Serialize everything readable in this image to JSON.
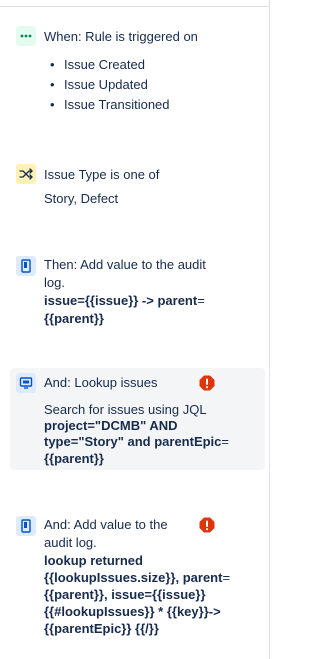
{
  "steps": [
    {
      "title": "When: Rule is triggered on",
      "icon": "trigger-icon",
      "items": [
        "Issue Created",
        "Issue Updated",
        "Issue Transitioned"
      ]
    },
    {
      "title": "Issue Type is one of",
      "icon": "shuffle-icon",
      "lines": [
        "Story, Defect"
      ]
    },
    {
      "title_lines": [
        "Then: Add value to the audit",
        "log."
      ],
      "icon": "audit-log-icon",
      "lines": [
        [
          "issue",
          "={{issue}} -> ",
          "parent",
          "="
        ],
        [
          "{{parent}}"
        ]
      ]
    },
    {
      "title": "And: Lookup issues",
      "icon": "lookup-icon",
      "warning": true,
      "lines": [
        "Search for issues using JQL",
        "project=\"DCMB\" AND",
        "type=\"Story\" and parentEpic",
        "=",
        "{{parent}}"
      ]
    },
    {
      "title_lines": [
        "And: Add value to the",
        "audit log."
      ],
      "icon": "audit-log-icon",
      "warning": true,
      "lines": [
        "lookup returned",
        "{{lookupIssues.size}}, parent",
        "=",
        "{{parent}}, issue={{issue}}",
        "{{#lookupIssues}} * {{key}}->",
        "{{parentEpic}} {{/}}"
      ]
    }
  ],
  "colors": {
    "text": "#172b4d",
    "trigger_bg": "#e3fcef",
    "trigger_fg": "#00875a",
    "condition_bg": "#fff0b3",
    "condition_fg": "#172b4d",
    "action_bg": "#deebff",
    "action_fg": "#0052cc",
    "warning": "#de350b",
    "highlight_bg": "#f4f5f7"
  }
}
